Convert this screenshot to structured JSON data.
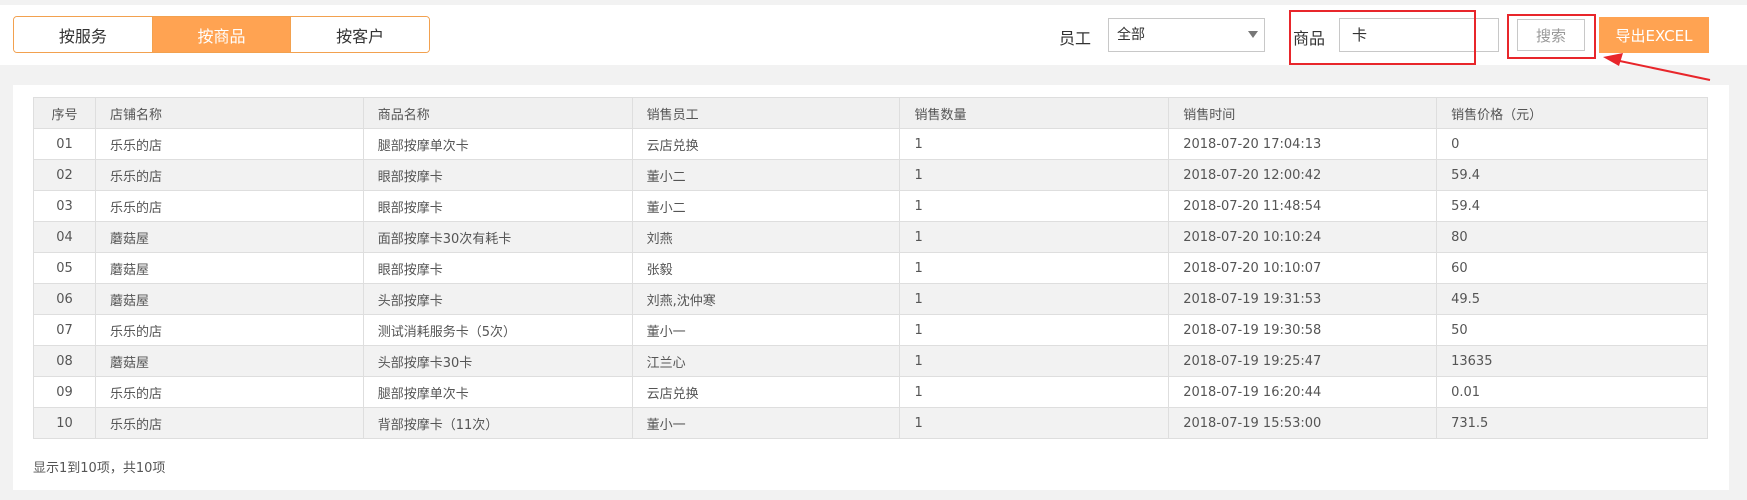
{
  "tabs": [
    {
      "label": "按服务",
      "active": false
    },
    {
      "label": "按商品",
      "active": true
    },
    {
      "label": "按客户",
      "active": false
    }
  ],
  "filters": {
    "employee_label": "员工",
    "employee_value": "全部",
    "product_label": "商品",
    "product_value": "卡"
  },
  "buttons": {
    "search": "搜索",
    "export": "导出EXCEL"
  },
  "table": {
    "columns": [
      "序号",
      "店铺名称",
      "商品名称",
      "销售员工",
      "销售数量",
      "销售时间",
      "销售价格（元）"
    ],
    "rows": [
      [
        "01",
        "乐乐的店",
        "腿部按摩单次卡",
        "云店兑换",
        "1",
        "2018-07-20 17:04:13",
        "0"
      ],
      [
        "02",
        "乐乐的店",
        "眼部按摩卡",
        "董小二",
        "1",
        "2018-07-20 12:00:42",
        "59.4"
      ],
      [
        "03",
        "乐乐的店",
        "眼部按摩卡",
        "董小二",
        "1",
        "2018-07-20 11:48:54",
        "59.4"
      ],
      [
        "04",
        "蘑菇屋",
        "面部按摩卡30次有耗卡",
        "刘燕",
        "1",
        "2018-07-20 10:10:24",
        "80"
      ],
      [
        "05",
        "蘑菇屋",
        "眼部按摩卡",
        "张毅",
        "1",
        "2018-07-20 10:10:07",
        "60"
      ],
      [
        "06",
        "蘑菇屋",
        "头部按摩卡",
        "刘燕,沈仲寒",
        "1",
        "2018-07-19 19:31:53",
        "49.5"
      ],
      [
        "07",
        "乐乐的店",
        "测试消耗服务卡（5次）",
        "董小一",
        "1",
        "2018-07-19 19:30:58",
        "50"
      ],
      [
        "08",
        "蘑菇屋",
        "头部按摩卡30卡",
        "江兰心",
        "1",
        "2018-07-19 19:25:47",
        "13635"
      ],
      [
        "09",
        "乐乐的店",
        "腿部按摩单次卡",
        "云店兑换",
        "1",
        "2018-07-19 16:20:44",
        "0.01"
      ],
      [
        "10",
        "乐乐的店",
        "背部按摩卡（11次）",
        "董小一",
        "1",
        "2018-07-19 15:53:00",
        "731.5"
      ]
    ]
  },
  "summary": "显示1到10项，共10项",
  "colors": {
    "accent": "#ffa352",
    "annotation": "#e8262b"
  }
}
